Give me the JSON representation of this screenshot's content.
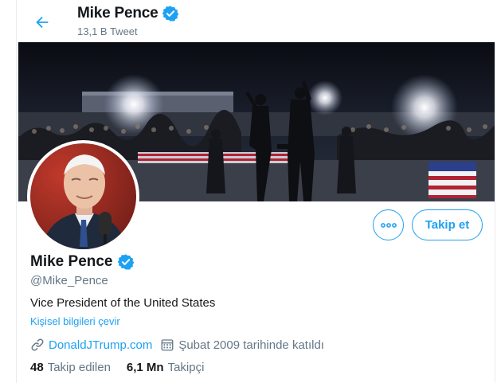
{
  "header": {
    "name": "Mike Pence",
    "tweet_count": "13,1 B Tweet"
  },
  "profile": {
    "name": "Mike Pence",
    "handle": "@Mike_Pence",
    "bio": "Vice President of the United States",
    "translate_link": "Kişisel bilgileri çevir",
    "website": "DonaldJTrump.com",
    "joined": "Şubat 2009 tarihinde katıldı"
  },
  "actions": {
    "follow_label": "Takip et"
  },
  "stats": {
    "following_count": "48",
    "following_label": "Takip edilen",
    "followers_count": "6,1 Mn",
    "followers_label": "Takipçi"
  },
  "icons": {
    "back": "arrow-left-icon",
    "verified": "verified-badge-icon",
    "more": "more-dots-icon",
    "link": "link-icon",
    "calendar": "calendar-icon"
  },
  "colors": {
    "accent": "#1da1f2",
    "text": "#14171a",
    "secondary": "#657786"
  }
}
